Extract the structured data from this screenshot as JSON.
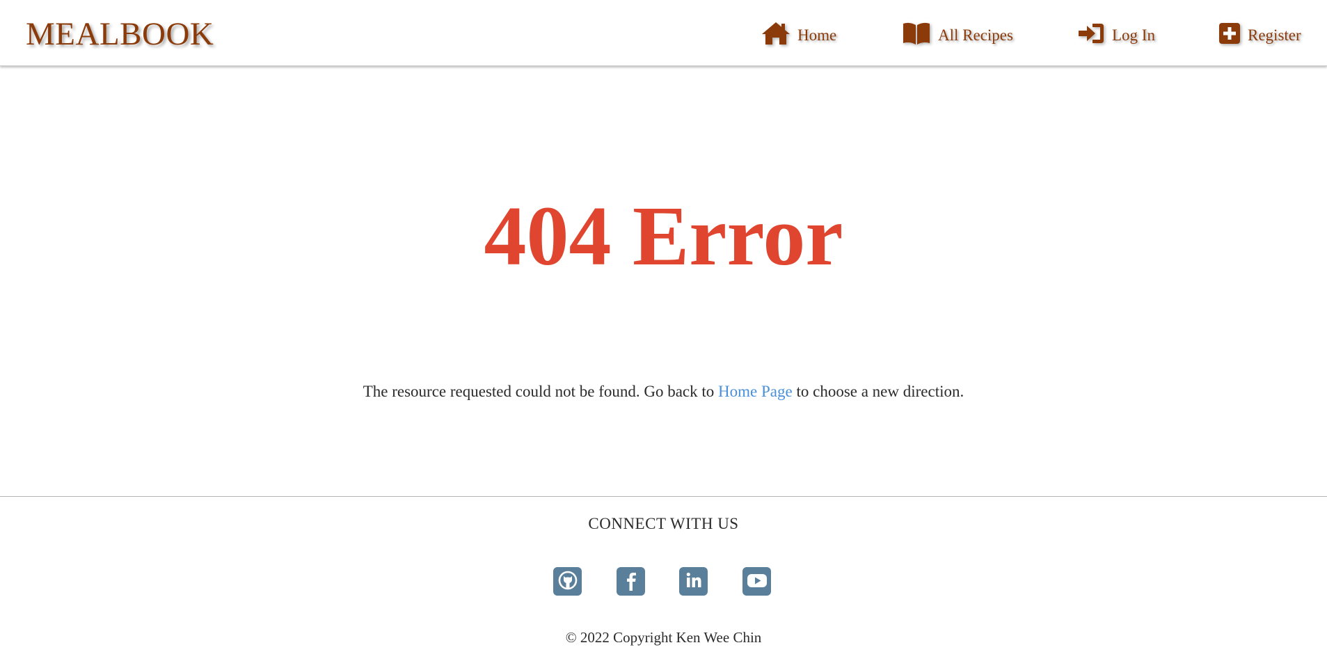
{
  "brand": {
    "name": "MEALBOOK",
    "color": "#8b3a0a"
  },
  "nav": {
    "items": [
      {
        "label": "Home",
        "icon": "home-icon"
      },
      {
        "label": "All Recipes",
        "icon": "open-book-icon"
      },
      {
        "label": "Log In",
        "icon": "sign-in-icon"
      },
      {
        "label": "Register",
        "icon": "plus-square-icon"
      }
    ]
  },
  "main": {
    "title": "404 Error",
    "title_color": "#e0452f",
    "message_before": "The resource requested could not be found. Go back to",
    "link_text": "Home Page",
    "link_color": "#4a90d9",
    "message_after": "to choose a new direction."
  },
  "footer": {
    "heading": "CONNECT WITH US",
    "social": [
      {
        "icon": "github-icon"
      },
      {
        "icon": "facebook-icon"
      },
      {
        "icon": "linkedin-icon"
      },
      {
        "icon": "youtube-icon"
      }
    ],
    "social_color": "#5a7f9b",
    "copyright": "© 2022 Copyright Ken Wee Chin"
  }
}
